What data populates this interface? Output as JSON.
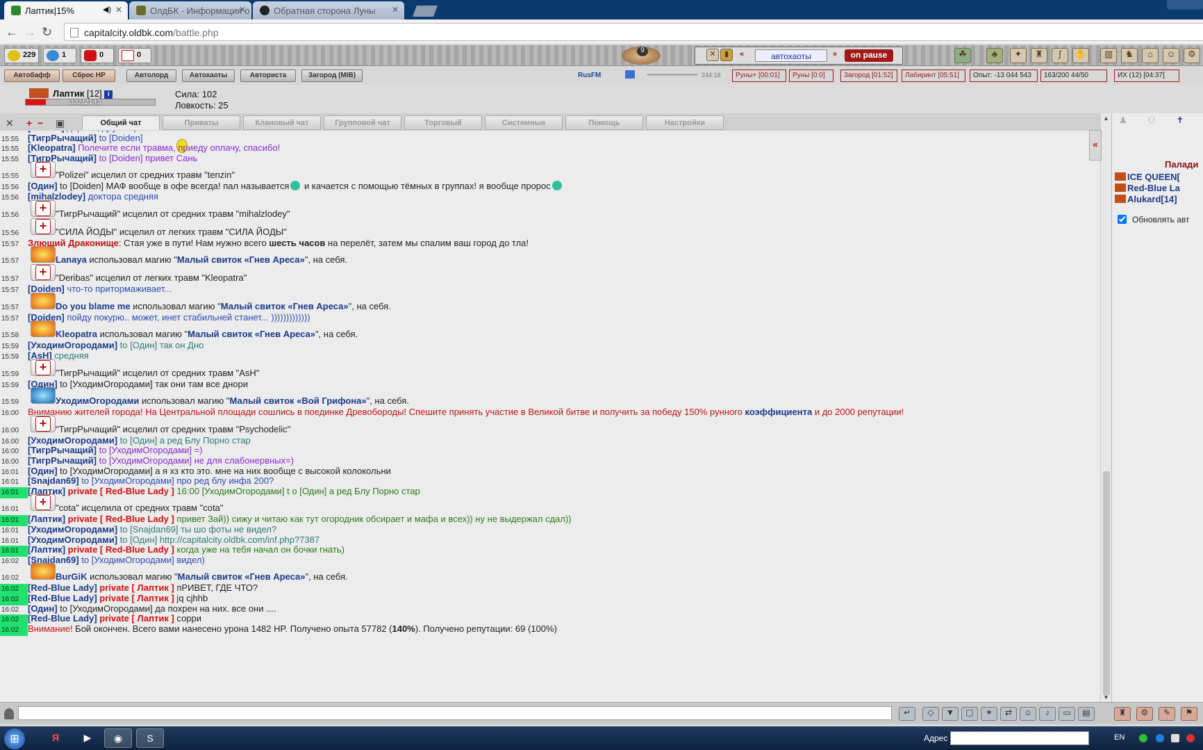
{
  "browser": {
    "tabs": [
      {
        "title": "Лаптик|15%",
        "active": true
      },
      {
        "title": "ОлдБК - Информация о",
        "active": false
      },
      {
        "title": "Обратная сторона Луны",
        "active": false
      }
    ],
    "url_host": "capitalcity.oldbk.com",
    "url_path": "/battle.php"
  },
  "counters": [
    {
      "icon": "coin-icon",
      "value": "229"
    },
    {
      "icon": "globe-icon",
      "value": "1"
    },
    {
      "icon": "heart-icon",
      "value": "0"
    },
    {
      "icon": "medkit-icon",
      "value": "0"
    }
  ],
  "potion_count": "9",
  "autobattle": {
    "prev": "«",
    "label": "автохаоты",
    "next": "»",
    "pause": "on pause"
  },
  "action_buttons": [
    "Автобафф",
    "Сброс HP",
    "Автолорд",
    "Автохаоты",
    "Авториста",
    "Загород (MIB)"
  ],
  "radio": {
    "name": "RusFM",
    "time": "244:18"
  },
  "status_bar": [
    "Руны+ [00:01]",
    "Руны [0:0]",
    "Загород [01:52]",
    "Лабиринт [05:51]",
    "Опыт: -13 044 543",
    "163/200",
    "44/50",
    "ИХ (12)",
    "[04:37]"
  ],
  "player": {
    "name": "Лаптик",
    "level": "[12]",
    "hp": "332/2143",
    "hp_fraction": 0.155,
    "stats": [
      "Сила: 102",
      "Ловкость: 25"
    ]
  },
  "chat_tabs": [
    "Общий чат",
    "Приваты",
    "Клановый чат",
    "Групповой чат",
    "Торговый",
    "Системные",
    "Помощь",
    "Настройки"
  ],
  "chat": [
    {
      "t": "15:55",
      "parts": [
        [
          "n",
          "[Doiden]"
        ],
        [
          "b",
          " дарова, дружище!"
        ]
      ]
    },
    {
      "t": "15:55",
      "parts": [
        [
          "n",
          "[ТигрРычащий]"
        ],
        [
          "b",
          " to [Doiden]"
        ]
      ]
    },
    {
      "t": "15:55",
      "parts": [
        [
          "n",
          "[Kleopatra]"
        ],
        [
          "v",
          " Полечите если травма, приеду оплачу, спасибо!"
        ]
      ]
    },
    {
      "t": "15:55",
      "parts": [
        [
          "n",
          "[ТигрРычащий]"
        ],
        [
          "v",
          " to [Doiden] привет Сань"
        ]
      ]
    },
    {
      "t": "15:55",
      "icon": "heal",
      "parts": [
        [
          "d",
          "\"Polizei\" исцелил от средних травм \"tenzin\""
        ]
      ]
    },
    {
      "t": "15:56",
      "parts": [
        [
          "n",
          "[Один]"
        ],
        [
          "d",
          " to [Doiden] МАФ вообще в офе всегда! пал называется"
        ],
        [
          "s",
          ""
        ],
        [
          "d",
          " и качается с помощью тёмных в группах! я вообще проpос"
        ],
        [
          "s",
          ""
        ]
      ]
    },
    {
      "t": "15:56",
      "parts": [
        [
          "n",
          "[mihalzlodey]"
        ],
        [
          "b",
          " доктора средняя"
        ]
      ]
    },
    {
      "t": "15:56",
      "icon": "heal",
      "parts": [
        [
          "d",
          "\"ТигрРычащий\" исцелил от средних травм \"mihalzlodey\""
        ]
      ]
    },
    {
      "t": "15:56",
      "icon": "heal",
      "parts": [
        [
          "d",
          "\"СИЛА ЙОДЫ\" исцелил от легких травм \"СИЛА ЙОДЫ\""
        ]
      ]
    },
    {
      "t": "15:57",
      "parts": [
        [
          "dr",
          "Злющий Драконище"
        ],
        [
          "d",
          ": Стая уже в пути! Нам нужно всего "
        ],
        [
          "db",
          "шесть часов"
        ],
        [
          "d",
          " на перелёт, затем мы спалим ваш город до тла!"
        ]
      ]
    },
    {
      "t": "15:57",
      "icon": "fire",
      "parts": [
        [
          "sp",
          "Lanaya"
        ],
        [
          "d",
          " использовал магию \""
        ],
        [
          "sp",
          "Малый свиток «Гнев Ареса»"
        ],
        [
          "d",
          "\", на себя."
        ]
      ]
    },
    {
      "t": "15:57",
      "icon": "heal",
      "parts": [
        [
          "d",
          "\"Deribas\" исцелил от легких травм \"Kleopatra\""
        ]
      ]
    },
    {
      "t": "15:57",
      "parts": [
        [
          "n",
          "[Doiden]"
        ],
        [
          "b",
          " что-то притормаживает..."
        ]
      ]
    },
    {
      "t": "15:57",
      "icon": "fire",
      "parts": [
        [
          "sp",
          "Do you blame me"
        ],
        [
          "d",
          " использовал магию \""
        ],
        [
          "sp",
          "Малый свиток «Гнев Ареса»"
        ],
        [
          "d",
          "\", на себя."
        ]
      ]
    },
    {
      "t": "15:57",
      "parts": [
        [
          "n",
          "[Doiden]"
        ],
        [
          "b",
          " пойду покурю.. может, инет стабильней станет... )))))))))))))"
        ]
      ]
    },
    {
      "t": "15:58",
      "icon": "fire",
      "parts": [
        [
          "sp",
          "Kleopatra"
        ],
        [
          "d",
          " использовал магию \""
        ],
        [
          "sp",
          "Малый свиток «Гнев Ареса»"
        ],
        [
          "d",
          "\", на себя."
        ]
      ]
    },
    {
      "t": "15:59",
      "parts": [
        [
          "n",
          "[УходимОгородами]"
        ],
        [
          "t",
          " to [Один] так он Дно"
        ]
      ]
    },
    {
      "t": "15:59",
      "parts": [
        [
          "n",
          "[AsH]"
        ],
        [
          "t",
          " средняя"
        ]
      ]
    },
    {
      "t": "15:59",
      "icon": "heal",
      "parts": [
        [
          "d",
          "\"ТигрРычащий\" исцелил от средних травм \"AsH\""
        ]
      ]
    },
    {
      "t": "15:59",
      "parts": [
        [
          "n",
          "[Один]"
        ],
        [
          "d",
          " to [УходимОгородами] так они там все днори"
        ]
      ]
    },
    {
      "t": "15:59",
      "icon": "griffin",
      "parts": [
        [
          "sp",
          "УходимОгородами"
        ],
        [
          "d",
          " использовал магию \""
        ],
        [
          "sp",
          "Малый свиток «Вой Грифона»"
        ],
        [
          "d",
          "\", на себя."
        ]
      ]
    },
    {
      "t": "16:00",
      "parts": [
        [
          "r",
          "Вниманию жителей города! На Центральной площади сошлись в поединке Древобороды! Спешите принять участие в Великой битве и получить за победу 150% рунного "
        ],
        [
          "sp",
          "коэффициента"
        ],
        [
          "r",
          " и до 2000 репутации!"
        ]
      ]
    },
    {
      "t": "16:00",
      "icon": "heal",
      "parts": [
        [
          "d",
          "\"ТигрРычащий\" исцелил от средних травм \"Psychodelic\""
        ]
      ]
    },
    {
      "t": "16:00",
      "parts": [
        [
          "n",
          "[УходимОгородами]"
        ],
        [
          "t",
          " to [Один] а ред Блу Порно стар"
        ]
      ]
    },
    {
      "t": "16:00",
      "parts": [
        [
          "n",
          "[ТигрРычащий]"
        ],
        [
          "v",
          " to [УходимОгородами] =)"
        ]
      ]
    },
    {
      "t": "16:00",
      "parts": [
        [
          "n",
          "[ТигрРычащий]"
        ],
        [
          "v",
          " to [УходимОгородами] не для слабонервных=)"
        ]
      ]
    },
    {
      "t": "16:01",
      "parts": [
        [
          "n",
          "[Один]"
        ],
        [
          "d",
          " to [УходимОгородами] а я хз кто это. мне на них вообще с высокой колокольни"
        ]
      ]
    },
    {
      "t": "16:01",
      "parts": [
        [
          "n",
          "[Snajdan69]"
        ],
        [
          "b",
          " to [УходимОгородами] про ред блу инфа 200?"
        ]
      ]
    },
    {
      "t": "16:01",
      "hl": true,
      "parts": [
        [
          "n",
          "[Лаптик]"
        ],
        [
          "p",
          " private [ Red-Blue Lady ]"
        ],
        [
          "g",
          " 16:00 [УходимОгородами] t o [Один] а ред Блу Порно стар"
        ]
      ]
    },
    {
      "t": "16:01",
      "icon": "heal",
      "parts": [
        [
          "d",
          "\"cota\" исцелила от средних травм \"cota\""
        ]
      ]
    },
    {
      "t": "16:01",
      "hl": true,
      "parts": [
        [
          "n",
          "[Лаптик]"
        ],
        [
          "p",
          " private [ Red-Blue Lady ]"
        ],
        [
          "g",
          " привет Зай)) сижу и читаю как тут огородник обсирает и мафа и всех)) ну не выдержал сдал))"
        ]
      ]
    },
    {
      "t": "16:01",
      "parts": [
        [
          "n",
          "[УходимОгородами]"
        ],
        [
          "t",
          " to [Snajdan69] ты шо фоты не видел?"
        ]
      ]
    },
    {
      "t": "16:01",
      "parts": [
        [
          "n",
          "[УходимОгородами]"
        ],
        [
          "t",
          " to [Один] http://capitalcity.oldbk.com/inf.php?7387"
        ]
      ]
    },
    {
      "t": "16:01",
      "hl": true,
      "parts": [
        [
          "n",
          "[Лаптик]"
        ],
        [
          "p",
          " private [ Red-Blue Lady ]"
        ],
        [
          "g",
          " когда уже на тебя начал он бочки гнать)"
        ]
      ]
    },
    {
      "t": "16:02",
      "parts": [
        [
          "n",
          "[Snajdan69]"
        ],
        [
          "b",
          " to [УходимОгородами] видел)"
        ]
      ]
    },
    {
      "t": "16:02",
      "icon": "fire",
      "parts": [
        [
          "sp",
          "BurGiK"
        ],
        [
          "d",
          " использовал магию \""
        ],
        [
          "sp",
          "Малый свиток «Гнев Ареса»"
        ],
        [
          "d",
          "\", на себя."
        ]
      ]
    },
    {
      "t": "16:02",
      "hl": true,
      "parts": [
        [
          "n",
          "[Red-Blue Lady]"
        ],
        [
          "p",
          " private [ Лаптик ]"
        ],
        [
          "d",
          " пРИВЕТ, ГДЕ ЧТО?"
        ]
      ]
    },
    {
      "t": "16:02",
      "hl": true,
      "parts": [
        [
          "n",
          "[Red-Blue Lady]"
        ],
        [
          "p",
          " private [ Лаптик ]"
        ],
        [
          "d",
          " jq cjhhb"
        ]
      ]
    },
    {
      "t": "16:02",
      "parts": [
        [
          "n",
          "[Один]"
        ],
        [
          "d",
          " to [УходимОгородами] да похрен на них. все они ...."
        ]
      ]
    },
    {
      "t": "16:02",
      "hl": true,
      "parts": [
        [
          "n",
          "[Red-Blue Lady]"
        ],
        [
          "p",
          " private [ Лаптик ]"
        ],
        [
          "d",
          " сорри"
        ]
      ]
    },
    {
      "t": "16:02",
      "hl": true,
      "parts": [
        [
          "r",
          "Внимание!"
        ],
        [
          "d",
          " Бой окончен. Всего вами нанесено урона 1482 HP. Получено опыта 57782 ("
        ],
        [
          "db",
          "140%"
        ],
        [
          "d",
          "). Получено репутации: 69 (100%)"
        ]
      ]
    }
  ],
  "right_panel": {
    "title": "Паладины",
    "title_visible": "Палади",
    "members": [
      "ICE QUEEN[",
      "Red-Blue La",
      "Alukard[14]"
    ],
    "checkbox_label": "Обновлять авт"
  },
  "taskbar": {
    "address_label": "Адрес",
    "lang": "EN"
  },
  "colors": {
    "highlight_time": "#22e070",
    "private": "#d01010",
    "nick": "#1a3a8a"
  }
}
